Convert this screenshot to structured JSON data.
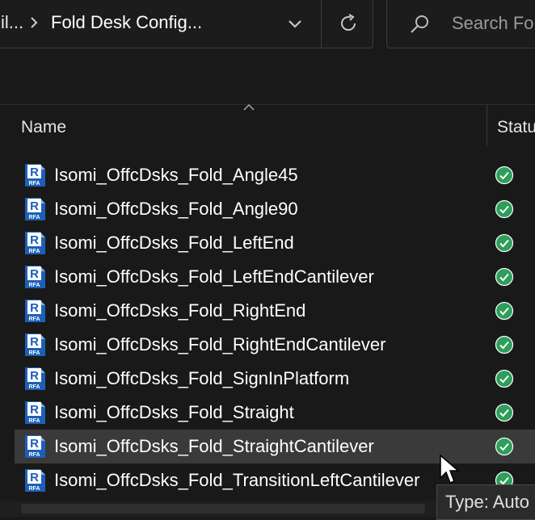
{
  "address_bar": {
    "prefix": "il...",
    "crumb": "Fold Desk Config..."
  },
  "search": {
    "placeholder": "Search Fo"
  },
  "columns": {
    "name": "Name",
    "status": "Statu"
  },
  "files": [
    {
      "name": "Isomi_OffcDsks_Fold_Angle45",
      "icon": "revit-family-icon",
      "status": "synced",
      "selected": false
    },
    {
      "name": "Isomi_OffcDsks_Fold_Angle90",
      "icon": "revit-family-icon",
      "status": "synced",
      "selected": false
    },
    {
      "name": "Isomi_OffcDsks_Fold_LeftEnd",
      "icon": "revit-family-icon",
      "status": "synced",
      "selected": false
    },
    {
      "name": "Isomi_OffcDsks_Fold_LeftEndCantilever",
      "icon": "revit-family-icon",
      "status": "synced",
      "selected": false
    },
    {
      "name": "Isomi_OffcDsks_Fold_RightEnd",
      "icon": "revit-family-icon",
      "status": "synced",
      "selected": false
    },
    {
      "name": "Isomi_OffcDsks_Fold_RightEndCantilever",
      "icon": "revit-family-icon",
      "status": "synced",
      "selected": false
    },
    {
      "name": "Isomi_OffcDsks_Fold_SignInPlatform",
      "icon": "revit-family-icon",
      "status": "synced",
      "selected": false
    },
    {
      "name": "Isomi_OffcDsks_Fold_Straight",
      "icon": "revit-family-icon",
      "status": "synced",
      "selected": false
    },
    {
      "name": "Isomi_OffcDsks_Fold_StraightCantilever",
      "icon": "revit-family-icon",
      "status": "synced",
      "selected": true
    },
    {
      "name": "Isomi_OffcDsks_Fold_TransitionLeftCantilever",
      "icon": "revit-family-icon",
      "status": "synced",
      "selected": false
    }
  ],
  "file_icon_text": {
    "letter": "R",
    "ext": "RFA"
  },
  "tooltip": {
    "text": "Type: Auto"
  },
  "colors": {
    "background": "#191919",
    "selected_row": "#3a3a3a",
    "status_green": "#2e9e5b",
    "revit_blue": "#1c5fb8"
  }
}
